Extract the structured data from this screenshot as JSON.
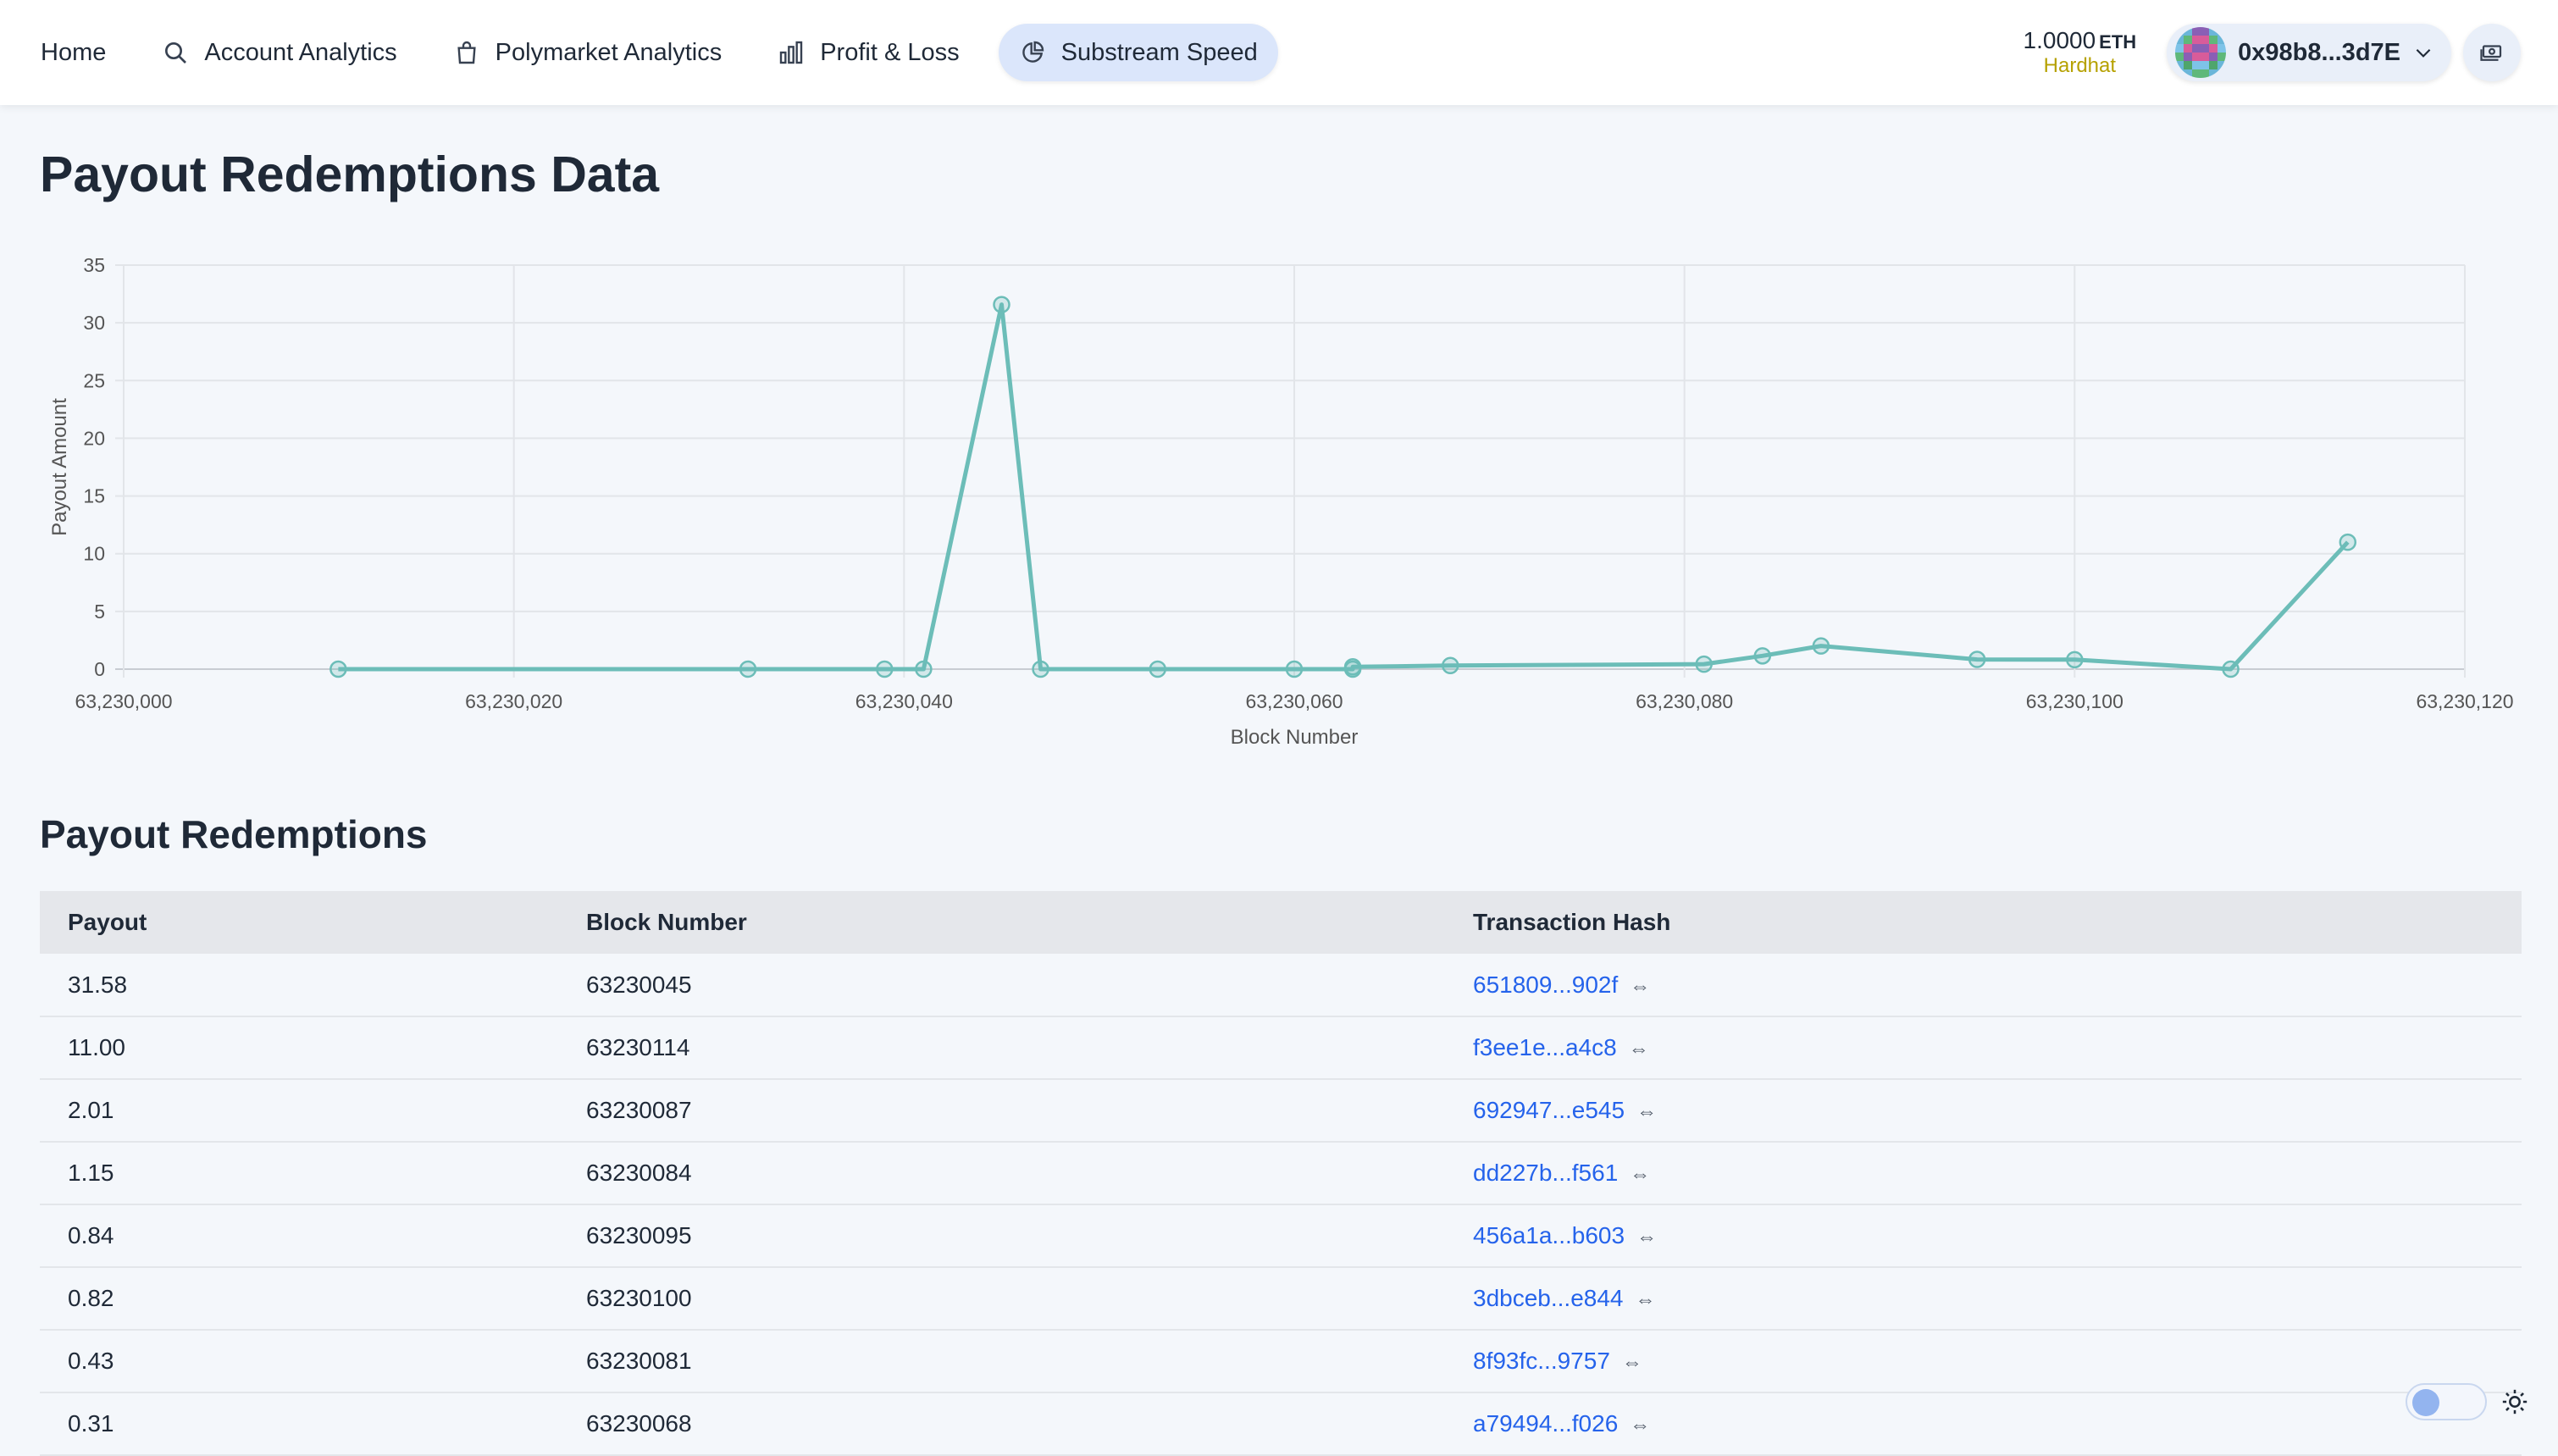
{
  "nav": {
    "items": [
      {
        "label": "Home",
        "icon": "",
        "active": false
      },
      {
        "label": "Account Analytics",
        "icon": "search-icon",
        "active": false
      },
      {
        "label": "Polymarket Analytics",
        "icon": "shopping-bag-icon",
        "active": false
      },
      {
        "label": "Profit & Loss",
        "icon": "bar-chart-icon",
        "active": false
      },
      {
        "label": "Substream Speed",
        "icon": "pie-chart-icon",
        "active": true
      }
    ],
    "balance": {
      "amount": "1.0000",
      "unit": "ETH",
      "network": "Hardhat"
    },
    "account": {
      "address": "0x98b8...3d7E"
    },
    "colors": {
      "accent_bg": "#dbe6fb",
      "network": "#b6a100"
    }
  },
  "page": {
    "title": "Payout Redemptions Data"
  },
  "chart_data": {
    "type": "line",
    "xlabel": "Block Number",
    "ylabel": "Payout Amount",
    "xlim": [
      63230000,
      63230120
    ],
    "ylim": [
      0,
      35
    ],
    "x_ticks": [
      "63,230,000",
      "63,230,020",
      "63,230,040",
      "63,230,060",
      "63,230,080",
      "63,230,100",
      "63,230,120"
    ],
    "y_ticks": [
      "0",
      "5",
      "10",
      "15",
      "20",
      "25",
      "30",
      "35"
    ],
    "grid": true,
    "line_color": "#6cbdb8",
    "points": [
      {
        "x": 63230011,
        "y": 0.0
      },
      {
        "x": 63230032,
        "y": 0.0
      },
      {
        "x": 63230039,
        "y": 0.0
      },
      {
        "x": 63230041,
        "y": 0.0
      },
      {
        "x": 63230045,
        "y": 31.58
      },
      {
        "x": 63230047,
        "y": 0.0
      },
      {
        "x": 63230053,
        "y": 0.0
      },
      {
        "x": 63230060,
        "y": 0.0
      },
      {
        "x": 63230063,
        "y": 0.0
      },
      {
        "x": 63230063,
        "y": 0.2
      },
      {
        "x": 63230068,
        "y": 0.31
      },
      {
        "x": 63230081,
        "y": 0.43
      },
      {
        "x": 63230084,
        "y": 1.15
      },
      {
        "x": 63230087,
        "y": 2.01
      },
      {
        "x": 63230095,
        "y": 0.84
      },
      {
        "x": 63230100,
        "y": 0.82
      },
      {
        "x": 63230108,
        "y": 0.0
      },
      {
        "x": 63230114,
        "y": 11.0
      }
    ]
  },
  "table": {
    "title": "Payout Redemptions",
    "headers": [
      "Payout",
      "Block Number",
      "Transaction Hash"
    ],
    "rows": [
      {
        "payout": "31.58",
        "block": "63230045",
        "hash": "651809...902f"
      },
      {
        "payout": "11.00",
        "block": "63230114",
        "hash": "f3ee1e...a4c8"
      },
      {
        "payout": "2.01",
        "block": "63230087",
        "hash": "692947...e545"
      },
      {
        "payout": "1.15",
        "block": "63230084",
        "hash": "dd227b...f561"
      },
      {
        "payout": "0.84",
        "block": "63230095",
        "hash": "456a1a...b603"
      },
      {
        "payout": "0.82",
        "block": "63230100",
        "hash": "3dbceb...e844"
      },
      {
        "payout": "0.43",
        "block": "63230081",
        "hash": "8f93fc...9757"
      },
      {
        "payout": "0.31",
        "block": "63230068",
        "hash": "a79494...f026"
      }
    ],
    "copy_symbol": "⇔"
  }
}
